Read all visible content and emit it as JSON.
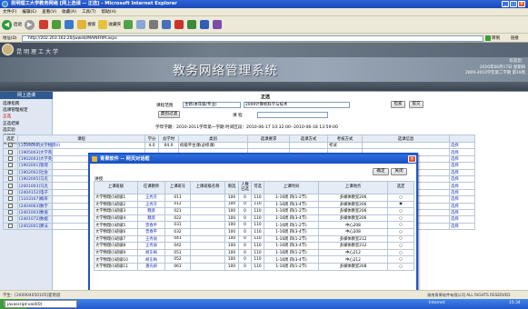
{
  "window": {
    "title": "昆明理工大学教务网络 [网上选课 -- 正选] - Microsoft Internet Explorer"
  },
  "menu": [
    "文件(F)",
    "编辑(E)",
    "查看(V)",
    "收藏(A)",
    "工具(T)",
    "帮助(H)"
  ],
  "toolbar": {
    "back": "后退",
    "search": "搜索",
    "favorites": "收藏夹"
  },
  "address": {
    "url": "http://202.203.162.20/jwweb/MAINFRM.aspx",
    "go": "转到",
    "links": "链接"
  },
  "header": {
    "school": "昆明理工大学",
    "system_title": "教务网络管理系统",
    "user_line1": "欢迎您：",
    "user_line2": "2010年06月17日 星期四",
    "user_line3": "2009-2010学年第二学期 第19周"
  },
  "sidebar": {
    "title": "网上选课",
    "items": [
      "选课指南",
      "选课管理规定",
      "正选",
      "正选结果",
      "选实验",
      "选环节",
      "提交课程+需要教材"
    ]
  },
  "form": {
    "section_title": "正选",
    "scope_label": "课程范围",
    "scope_value": "主修(本年级/专业)",
    "major_value": "2009计算机科学与技术",
    "search_btn": "检索",
    "submit_btn": "提交",
    "type_btn": "类别过滤",
    "course_label": "课  程",
    "info": "学年学期：2010-2011学年第一学期  时间区段：2010-06-17 10:32:00--2010-06-18 13:59:00"
  },
  "table": {
    "headers": [
      "选定",
      "课程",
      "学分",
      "总学时",
      "类别",
      "选课要求",
      "选课方式",
      "考核方式",
      "选课信息",
      ""
    ],
    "rows": [
      {
        "sel": "✓",
        "name": "[1104008]大学物理(Ⅰ)",
        "credit": "4.0",
        "hours": "64.0",
        "type": "校级平台课(必修课)",
        "req": "",
        "mode": "",
        "exam": "考试",
        "info": "",
        "op": "选择"
      },
      {
        "sel": "",
        "name": "[1905003]大学英",
        "credit": "",
        "hours": "",
        "type": "",
        "req": "",
        "mode": "",
        "exam": "",
        "info": "",
        "op": "选择"
      },
      {
        "sel": "",
        "name": "[1902003]大学英",
        "credit": "",
        "hours": "",
        "type": "",
        "req": "",
        "mode": "",
        "exam": "",
        "info": "",
        "op": "选择"
      },
      {
        "sel": "",
        "name": "[1902001]管理",
        "credit": "",
        "hours": "",
        "type": "",
        "req": "",
        "mode": "",
        "exam": "",
        "info": "",
        "op": "选择"
      },
      {
        "sel": "",
        "name": "[1902002]社会",
        "credit": "",
        "hours": "",
        "type": "",
        "req": "",
        "mode": "",
        "exam": "",
        "info": "",
        "op": "选择"
      },
      {
        "sel": "",
        "name": "[1902005]马克",
        "credit": "",
        "hours": "",
        "type": "",
        "req": "",
        "mode": "",
        "exam": "",
        "info": "",
        "op": "选择"
      },
      {
        "sel": "",
        "name": "[2001003]马克",
        "credit": "",
        "hours": "",
        "type": "",
        "req": "",
        "mode": "",
        "exam": "",
        "info": "",
        "op": "选择"
      },
      {
        "sel": "",
        "name": "[2404152]电子",
        "credit": "",
        "hours": "",
        "type": "",
        "req": "",
        "mode": "",
        "exam": "",
        "info": "",
        "op": "选择"
      },
      {
        "sel": "",
        "name": "[1103167]概率",
        "credit": "",
        "hours": "",
        "type": "",
        "req": "",
        "mode": "",
        "exam": "",
        "info": "",
        "op": "选择"
      },
      {
        "sel": "",
        "name": "[2404063]数字",
        "credit": "",
        "hours": "",
        "type": "",
        "req": "",
        "mode": "",
        "exam": "",
        "info": "",
        "op": "选择"
      },
      {
        "sel": "",
        "name": "[2401003]数值",
        "credit": "",
        "hours": "",
        "type": "",
        "req": "",
        "mode": "",
        "exam": "",
        "info": "",
        "op": "选择"
      },
      {
        "sel": "",
        "name": "[2401072]数据",
        "credit": "",
        "hours": "",
        "type": "",
        "req": "",
        "mode": "",
        "exam": "",
        "info": "",
        "op": "选择"
      },
      {
        "sel": "",
        "name": "[2402001]算法",
        "credit": "",
        "hours": "",
        "type": "",
        "req": "",
        "mode": "",
        "exam": "",
        "info": "",
        "op": "选择"
      }
    ]
  },
  "statusbar": {
    "left": "学生：[200904050105]崔明道",
    "right": "湖南青果软件有限公司 ALL RIGHTS RESERVED"
  },
  "taskbar": {
    "start": "开始",
    "item": "javascript:void(0)",
    "zone": "Internet",
    "time": "15:34"
  },
  "dialog": {
    "title": "青果软件 -- 网页对话框",
    "confirm": "确定",
    "close": "关闭",
    "label": "讲授",
    "headers": [
      "上课班级",
      "任课教师",
      "上课班号",
      "上课班级名称",
      "限选",
      "人数 已选",
      "可选",
      "上课时间",
      "上课地点",
      "选定"
    ],
    "rows": [
      [
        "大学物理(Ⅰ)班级1",
        "王秀芬",
        "011",
        "",
        "100",
        "0",
        "110",
        "1-16周 四(1-2节)",
        "多媒体教室206",
        "○"
      ],
      [
        "大学物理(Ⅰ)班级2",
        "王秀芬",
        "012",
        "",
        "100",
        "0",
        "110",
        "1-16周 四(3-4节)",
        "多媒体教室206",
        "◉"
      ],
      [
        "大学物理(Ⅰ)班级3",
        "魏渡",
        "021",
        "",
        "100",
        "0",
        "110",
        "1-16周 四(1-2节)",
        "多媒体教室206",
        "○"
      ],
      [
        "大学物理(Ⅰ)班级4",
        "魏渡",
        "022",
        "",
        "100",
        "0",
        "110",
        "1-16周 四(3-4节)",
        "多媒体教室206",
        "○"
      ],
      [
        "大学物理(Ⅰ)班级5",
        "曾春平",
        "031",
        "",
        "100",
        "0",
        "110",
        "1-16周 四(1-2节)",
        "中心208",
        "○"
      ],
      [
        "大学物理(Ⅰ)班级6",
        "曾春平",
        "032",
        "",
        "100",
        "0",
        "110",
        "1-16周 四(3-4节)",
        "中心208",
        "○"
      ],
      [
        "大学物理(Ⅰ)班级7",
        "王秀丽",
        "041",
        "",
        "100",
        "0",
        "110",
        "1-16周 四(1-2节)",
        "多媒体教室212",
        "○"
      ],
      [
        "大学物理(Ⅰ)班级8",
        "王秀丽",
        "042",
        "",
        "100",
        "0",
        "110",
        "1-16周 四(3-4节)",
        "多媒体教室212",
        "○"
      ],
      [
        "大学物理(Ⅰ)班级9",
        "胡东梅",
        "051",
        "",
        "100",
        "0",
        "110",
        "1-16周 四(1-2节)",
        "中心212",
        "○"
      ],
      [
        "大学物理(Ⅰ)班级10",
        "胡东梅",
        "052",
        "",
        "100",
        "0",
        "110",
        "1-16周 四(3-4节)",
        "中心212",
        "○"
      ],
      [
        "大学物理(Ⅰ)班级11",
        "潘光妍",
        "061",
        "",
        "100",
        "0",
        "110",
        "1-16周 四(1-2节)",
        "多媒体教室208",
        "○"
      ]
    ],
    "status_url": "http://202.203.162.20/jwweb/wsxk/stu_xszx_chooseskbj.aspx?lx=ZX&id=201009386000310"
  },
  "colors": {
    "title_bar": "#1b49b8",
    "sidebar_head": "#2f5a8e",
    "link": "#1a31b4"
  }
}
